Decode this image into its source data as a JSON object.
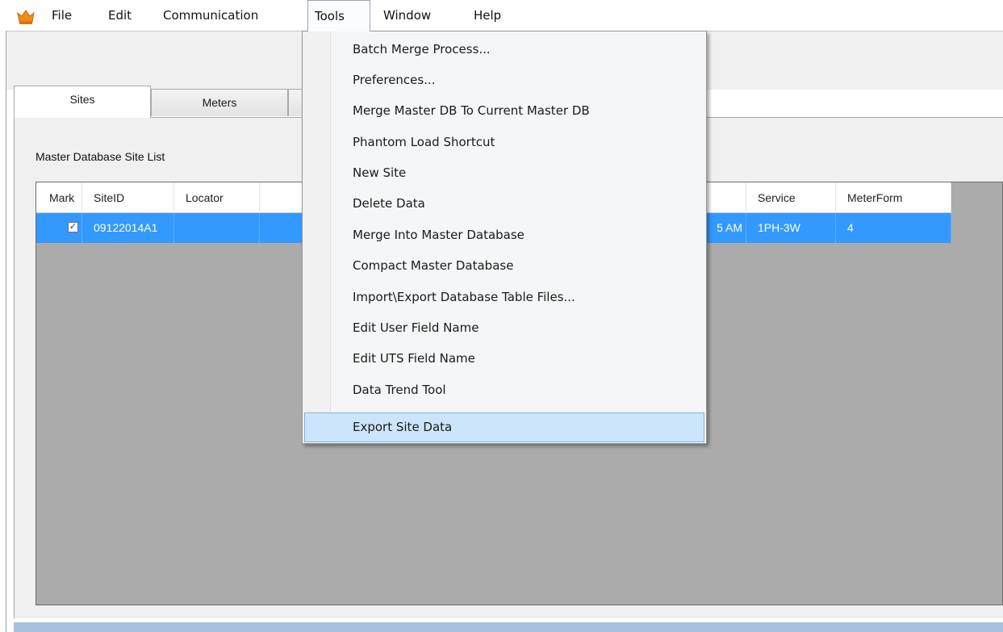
{
  "menubar": {
    "icon": "crown-icon",
    "items": [
      "File",
      "Edit",
      "Communication",
      "Tools",
      "Window",
      "Help"
    ],
    "open_menu": "Tools"
  },
  "tabs": [
    "Sites",
    "Meters"
  ],
  "active_tab": "Sites",
  "section_label": "Master Database Site List",
  "grid": {
    "columns": [
      "Mark",
      "SiteID",
      "Locator",
      "",
      "Service",
      "MeterForm"
    ],
    "rows": [
      {
        "mark": true,
        "site_id": "09122014A1",
        "locator": "",
        "time_fragment": "5 AM",
        "service": "1PH-3W",
        "meter_form": "4"
      }
    ]
  },
  "tools_menu": {
    "items": [
      "Batch Merge Process...",
      "Preferences...",
      "Merge Master DB To Current Master DB",
      "Phantom Load Shortcut",
      "New Site",
      "Delete Data",
      "Merge Into Master Database",
      "Compact Master Database",
      "Import\\Export Database Table Files...",
      "Edit User Field Name",
      "Edit UTS Field Name",
      "Data Trend Tool",
      "Export Site Data"
    ],
    "highlighted": "Export Site Data"
  },
  "colors": {
    "selection": "#3399ff",
    "menu_highlight": "#cce5fb",
    "grid_background": "#ababab"
  }
}
